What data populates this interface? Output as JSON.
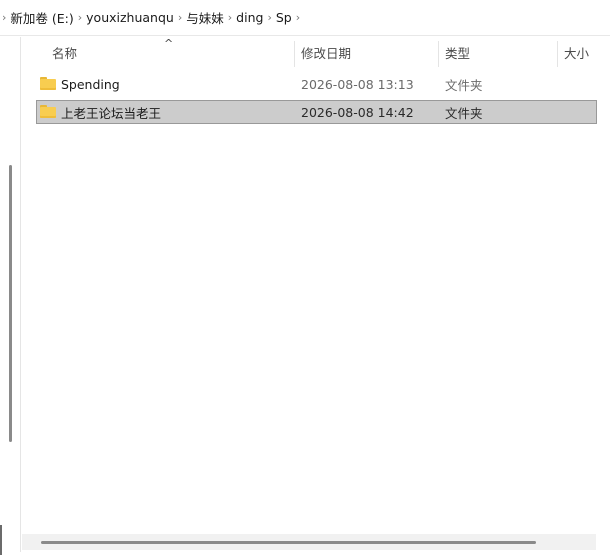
{
  "breadcrumb": {
    "items": [
      "新加卷 (E:)",
      "youxizhuanqu",
      "与妹妹",
      "ding",
      "Sp"
    ]
  },
  "columns": {
    "name": "名称",
    "modified": "修改日期",
    "type": "类型",
    "size": "大小",
    "sort_indicator": "^"
  },
  "files": [
    {
      "name": "Spending",
      "modified": "2026-08-08 13:13",
      "type": "文件夹",
      "selected": false
    },
    {
      "name": "上老王论坛当老王",
      "modified": "2026-08-08 14:42",
      "type": "文件夹",
      "selected": true
    }
  ],
  "colors": {
    "selection_bg": "#cccccc",
    "selection_border": "#999999",
    "folder_yellow": "#f8cd50"
  }
}
